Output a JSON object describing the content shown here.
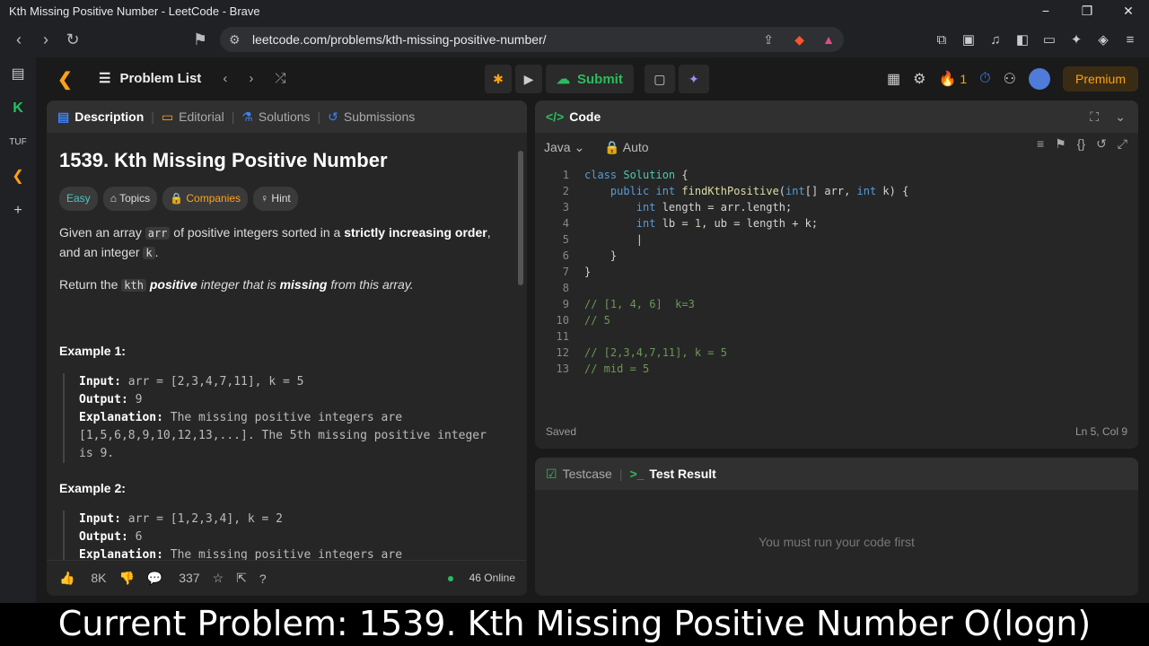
{
  "window": {
    "title": "Kth Missing Positive Number - LeetCode - Brave"
  },
  "browser": {
    "url": "leetcode.com/problems/kth-missing-positive-number/"
  },
  "header": {
    "problem_list_label": "Problem List",
    "submit_label": "Submit",
    "streak_count": "1",
    "premium_label": "Premium"
  },
  "left_tabs": [
    "Description",
    "Editorial",
    "Solutions",
    "Submissions"
  ],
  "problem": {
    "title": "1539. Kth Missing Positive Number",
    "difficulty": "Easy",
    "topics_label": "Topics",
    "companies_label": "Companies",
    "hint_label": "Hint",
    "desc1_a": "Given an array ",
    "desc1_code": "arr",
    "desc1_b": " of positive integers sorted in a ",
    "desc1_bold": "strictly increasing order",
    "desc1_c": ", and an integer ",
    "desc1_code2": "k",
    "desc1_d": ".",
    "desc2_a": "Return the ",
    "desc2_code": "kth",
    "desc2_bold": "positive",
    "desc2_b": " integer that is ",
    "desc2_bold2": "missing",
    "desc2_c": " from this array.",
    "examples": [
      {
        "title": "Example 1:",
        "input": "arr = [2,3,4,7,11], k = 5",
        "output": "9",
        "explanation": "The missing positive integers are [1,5,6,8,9,10,12,13,...]. The 5th missing positive integer is 9."
      },
      {
        "title": "Example 2:",
        "input": "arr = [1,2,3,4], k = 2",
        "output": "6",
        "explanation": "The missing positive integers are"
      }
    ],
    "labels": {
      "input": "Input:",
      "output": "Output:",
      "explanation": "Explanation:"
    }
  },
  "footer": {
    "likes": "8K",
    "comments": "337",
    "online": "46 Online"
  },
  "code_panel": {
    "title": "Code",
    "language": "Java",
    "mode": "Auto",
    "status_saved": "Saved",
    "cursor_pos": "Ln 5, Col 9",
    "lines": [
      {
        "n": "1",
        "text": "class Solution {"
      },
      {
        "n": "2",
        "text": "    public int findKthPositive(int[] arr, int k) {"
      },
      {
        "n": "3",
        "text": "        int length = arr.length;"
      },
      {
        "n": "4",
        "text": "        int lb = 1, ub = length + k;"
      },
      {
        "n": "5",
        "text": "        |"
      },
      {
        "n": "6",
        "text": "    }"
      },
      {
        "n": "7",
        "text": "}"
      },
      {
        "n": "8",
        "text": ""
      },
      {
        "n": "9",
        "text": "// [1, 4, 6]  k=3"
      },
      {
        "n": "10",
        "text": "// 5"
      },
      {
        "n": "11",
        "text": ""
      },
      {
        "n": "12",
        "text": "// [2,3,4,7,11], k = 5"
      },
      {
        "n": "13",
        "text": "// mid = 5"
      }
    ]
  },
  "test_panel": {
    "tab1": "Testcase",
    "tab2": "Test Result",
    "empty_msg": "You must run your code first"
  },
  "caption": "Current Problem: 1539. Kth Missing Positive Number O(logn)",
  "colors": {
    "accent": "#ffa116",
    "green": "#2cbb5d",
    "bg": "#1a1a1a"
  }
}
